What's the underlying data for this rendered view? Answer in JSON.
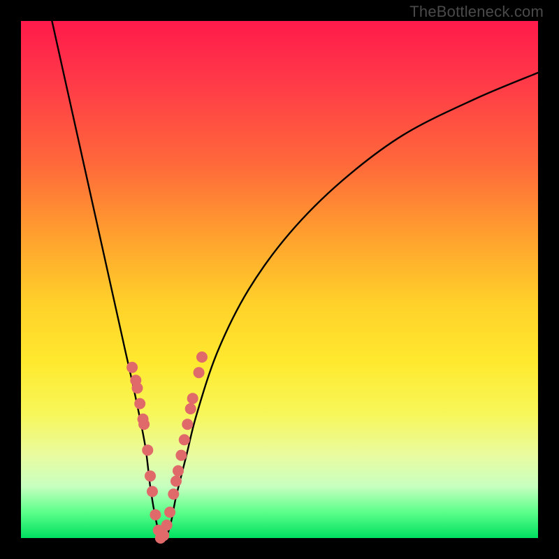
{
  "watermark": "TheBottleneck.com",
  "colors": {
    "frame": "#000000",
    "curve": "#000000",
    "marker_fill": "#e06a6a",
    "marker_stroke": "#d85a5a"
  },
  "chart_data": {
    "type": "line",
    "title": "",
    "xlabel": "",
    "ylabel": "",
    "xlim": [
      0,
      100
    ],
    "ylim": [
      0,
      100
    ],
    "description": "V-shaped bottleneck curve over rainbow vertical gradient (red top → green bottom). y≈0 at the bottom/minimum; the curve dips from top-left, reaches 0 near x≈27, then rises toward upper right with diminishing slope.",
    "series": [
      {
        "name": "bottleneck-curve",
        "x": [
          6,
          10,
          14,
          18,
          20,
          22,
          24,
          25,
          26,
          27,
          28,
          29,
          30,
          32,
          34,
          38,
          44,
          52,
          62,
          74,
          88,
          100
        ],
        "y": [
          100,
          82,
          64,
          46,
          37,
          28,
          18,
          10,
          4,
          0,
          0,
          3,
          8,
          16,
          24,
          36,
          48,
          59,
          69,
          78,
          85,
          90
        ]
      }
    ],
    "markers": {
      "comment": "salmon dots clustered along the lower part of the V, both arms",
      "x": [
        21.5,
        22.2,
        22.5,
        23.0,
        23.6,
        23.8,
        24.5,
        25.0,
        25.4,
        26.0,
        26.6,
        27.0,
        27.6,
        28.2,
        28.8,
        29.5,
        30.0,
        30.4,
        31.0,
        31.6,
        32.2,
        32.8,
        33.2,
        34.4,
        35.0
      ],
      "y": [
        33.0,
        30.5,
        29.0,
        26.0,
        23.0,
        22.0,
        17.0,
        12.0,
        9.0,
        4.5,
        1.5,
        0.0,
        0.5,
        2.5,
        5.0,
        8.5,
        11.0,
        13.0,
        16.0,
        19.0,
        22.0,
        25.0,
        27.0,
        32.0,
        35.0
      ],
      "r": 8
    }
  }
}
